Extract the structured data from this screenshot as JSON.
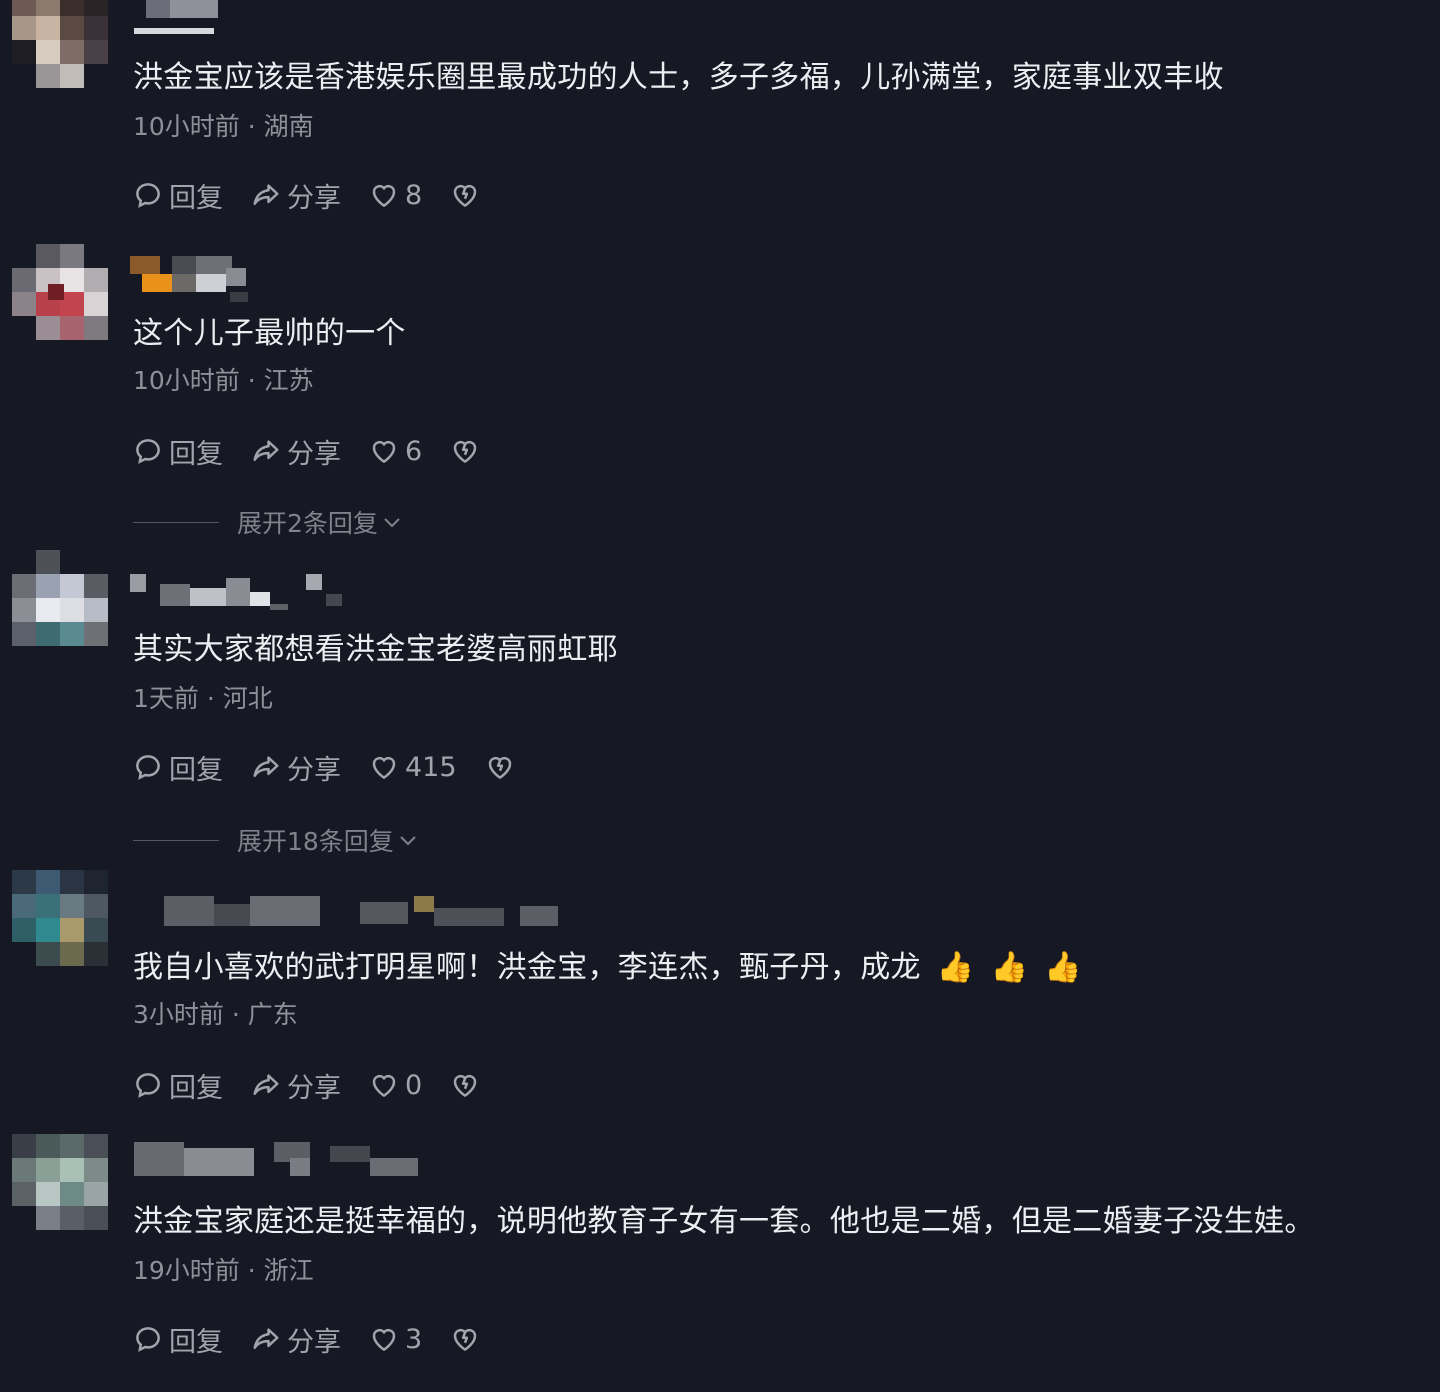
{
  "comments": [
    {
      "text": "洪金宝应该是香港娱乐圈里最成功的人士，多子多福，儿孙满堂，家庭事业双丰收",
      "time_location": "10小时前 · 湖南",
      "reply_label": "回复",
      "share_label": "分享",
      "likes": "8"
    },
    {
      "text": "这个儿子最帅的一个",
      "time_location": "10小时前 · 江苏",
      "reply_label": "回复",
      "share_label": "分享",
      "likes": "6",
      "expand_label": "展开2条回复"
    },
    {
      "text": "其实大家都想看洪金宝老婆高丽虹耶",
      "time_location": "1天前 · 河北",
      "reply_label": "回复",
      "share_label": "分享",
      "likes": "415",
      "expand_label": "展开18条回复"
    },
    {
      "text": "我自小喜欢的武打明星啊！洪金宝，李连杰，甄子丹，成龙",
      "emojis": [
        "👍",
        "👍",
        "👍"
      ],
      "time_location": "3小时前 · 广东",
      "reply_label": "回复",
      "share_label": "分享",
      "likes": "0"
    },
    {
      "text": "洪金宝家庭还是挺幸福的，说明他教育子女有一套。他也是二婚，但是二婚妻子没生娃。",
      "time_location": "19小时前 · 浙江",
      "reply_label": "回复",
      "share_label": "分享",
      "likes": "3"
    }
  ],
  "icons": {
    "reply": "comment-bubble-icon",
    "share": "share-arrow-icon",
    "like": "heart-icon",
    "dislike": "broken-heart-icon",
    "expand": "chevron-down-icon"
  },
  "colors": {
    "background": "#161823",
    "text": "#eceef2",
    "muted": "#8e909a",
    "action": "#a2a4ad"
  }
}
